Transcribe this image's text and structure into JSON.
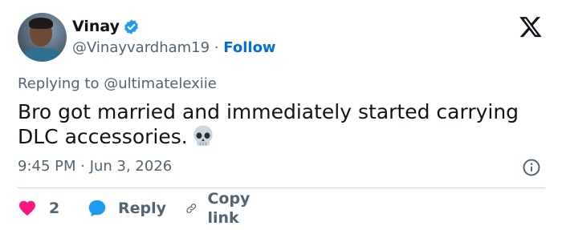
{
  "author": {
    "display_name": "Vinay",
    "handle": "@Vinayvardham19",
    "separator": "·",
    "follow_label": "Follow",
    "verified_color": "#1d9bf0"
  },
  "reply_context": {
    "prefix": "Replying to",
    "mention": "@ultimatelexiie"
  },
  "tweet": {
    "text": "Bro got married and immediately started carrying DLC accessories.",
    "emoji": "skull-emoji"
  },
  "meta": {
    "timestamp": "9:45 PM · Jun 3, 2026"
  },
  "actions": {
    "like_count": "2",
    "like_color": "#f91880",
    "reply_label": "Reply",
    "reply_color": "#1d9bf0",
    "copy_label": "Copy link"
  },
  "icons": {
    "logo": "x-logo-icon",
    "info": "info-icon",
    "like": "heart-icon",
    "reply": "speech-bubble-icon",
    "copy": "link-icon"
  }
}
